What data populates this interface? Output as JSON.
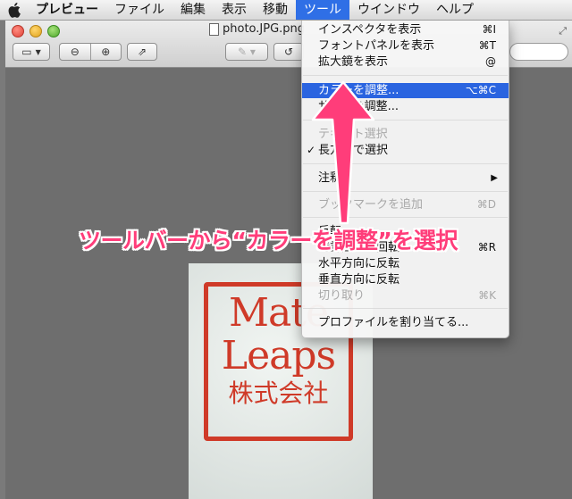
{
  "menubar": {
    "app_name": "プレビュー",
    "items": [
      "ファイル",
      "編集",
      "表示",
      "移動",
      "ツール",
      "ウインドウ",
      "ヘルプ"
    ]
  },
  "window": {
    "title": "photo.JPG.png"
  },
  "menu": {
    "items": [
      {
        "label": "インスペクタを表示",
        "shortcut": "⌘I"
      },
      {
        "label": "フォントパネルを表示",
        "shortcut": "⌘T"
      },
      {
        "label": "拡大鏡を表示",
        "shortcut": "@"
      },
      {
        "label": "カラーを調整...",
        "shortcut": "⌥⌘C"
      },
      {
        "label": "サイズを調整..."
      },
      {
        "label": "テキスト選択"
      },
      {
        "label": "長方形で選択"
      },
      {
        "label": "注釈"
      },
      {
        "label": "ブックマークを追加",
        "shortcut": "⌘D"
      },
      {
        "label": "反転"
      },
      {
        "label": "時計回りに回転",
        "shortcut": "⌘R"
      },
      {
        "label": "水平方向に反転"
      },
      {
        "label": "垂直方向に反転"
      },
      {
        "label": "切り取り",
        "shortcut": "⌘K"
      },
      {
        "label": "プロファイルを割り当てる..."
      }
    ]
  },
  "photo": {
    "stamp_line1": "Mate",
    "stamp_line2": "Leaps",
    "stamp_line3": "株式会社"
  },
  "annotation": {
    "caption": "ツールバーから“カラーを調整”を選択",
    "color": "#ff3d7a"
  },
  "colors": {
    "menu_highlight": "#2a64e0",
    "stamp_red": "#cf3a28"
  }
}
